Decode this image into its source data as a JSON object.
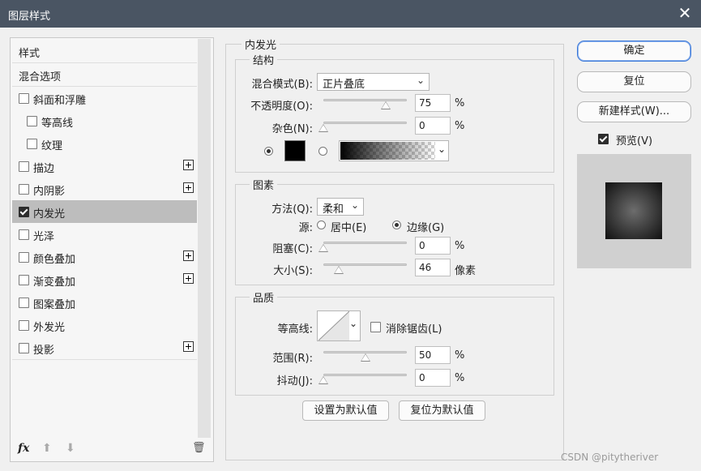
{
  "window": {
    "title": "图层样式",
    "close": "✕"
  },
  "left_list": {
    "header": "样式",
    "blend_options": "混合选项",
    "items": [
      {
        "label": "斜面和浮雕",
        "checked": false,
        "plus": false
      },
      {
        "label": "等高线",
        "checked": false,
        "plus": false
      },
      {
        "label": "纹理",
        "checked": false,
        "plus": false
      },
      {
        "label": "描边",
        "checked": false,
        "plus": true
      },
      {
        "label": "内阴影",
        "checked": false,
        "plus": true
      },
      {
        "label": "内发光",
        "checked": true,
        "plus": false,
        "selected": true
      },
      {
        "label": "光泽",
        "checked": false,
        "plus": false
      },
      {
        "label": "颜色叠加",
        "checked": false,
        "plus": true
      },
      {
        "label": "渐变叠加",
        "checked": false,
        "plus": true
      },
      {
        "label": "图案叠加",
        "checked": false,
        "plus": false
      },
      {
        "label": "外发光",
        "checked": false,
        "plus": false
      },
      {
        "label": "投影",
        "checked": false,
        "plus": true
      }
    ],
    "bottom": {
      "fx": "fx",
      "up": "⬆",
      "down": "⬇",
      "trash": "🗑"
    }
  },
  "panel": {
    "title": "内发光",
    "structure": {
      "legend": "结构",
      "blend_mode_label": "混合模式(B):",
      "blend_mode_value": "正片叠底",
      "opacity_label": "不透明度(O):",
      "opacity_value": "75",
      "noise_label": "杂色(N):",
      "noise_value": "0",
      "percent": "%",
      "sliders": {
        "opacity": 75,
        "noise": 0
      }
    },
    "elements": {
      "legend": "图素",
      "method_label": "方法(Q):",
      "method_value": "柔和",
      "source_label": "源:",
      "source_center": "居中(E)",
      "source_edge": "边缘(G)",
      "choke_label": "阻塞(C):",
      "choke_value": "0",
      "size_label": "大小(S):",
      "size_value": "46",
      "size_unit": "像素",
      "sliders": {
        "choke": 0,
        "size": 18
      }
    },
    "quality": {
      "legend": "品质",
      "contour_label": "等高线:",
      "anti_alias_label": "消除锯齿(L)",
      "range_label": "范围(R):",
      "range_value": "50",
      "jitter_label": "抖动(J):",
      "jitter_value": "0",
      "sliders": {
        "range": 50,
        "jitter": 0
      }
    },
    "make_default": "设置为默认值",
    "reset_default": "复位为默认值"
  },
  "right": {
    "ok": "确定",
    "reset": "复位",
    "new_style": "新建样式(W)...",
    "preview_label": "预览(V)",
    "preview_checked": true
  },
  "watermark": "CSDN @pitytheriver",
  "colors": {
    "titlebar": "#4a5563",
    "selected": "#bdbdbd",
    "accent": "#3b78d8"
  }
}
